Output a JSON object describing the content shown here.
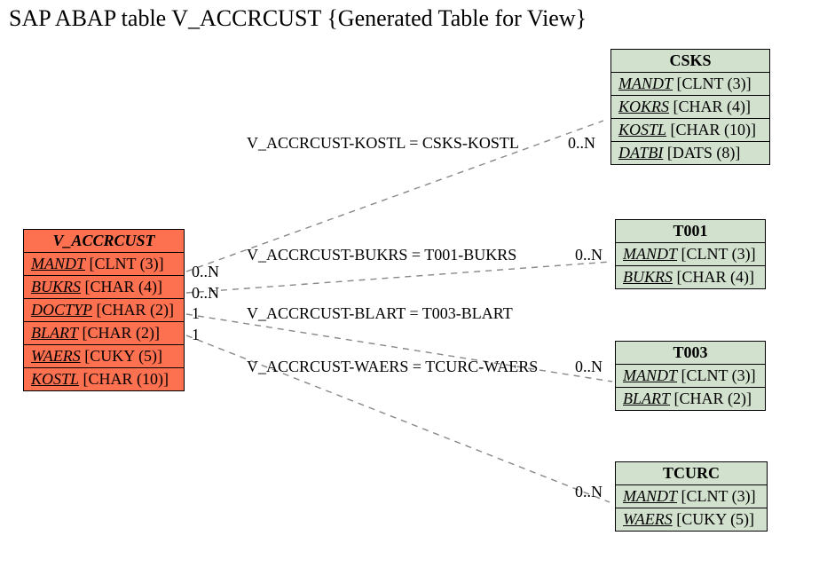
{
  "title": "SAP ABAP table V_ACCRCUST {Generated Table for View}",
  "main": {
    "name": "V_ACCRCUST",
    "fields": [
      {
        "name": "MANDT",
        "type": "[CLNT (3)]"
      },
      {
        "name": "BUKRS",
        "type": "[CHAR (4)]"
      },
      {
        "name": "DOCTYP",
        "type": "[CHAR (2)]"
      },
      {
        "name": "BLART",
        "type": "[CHAR (2)]"
      },
      {
        "name": "WAERS",
        "type": "[CUKY (5)]"
      },
      {
        "name": "KOSTL",
        "type": "[CHAR (10)]"
      }
    ]
  },
  "refs": {
    "csks": {
      "name": "CSKS",
      "fields": [
        {
          "name": "MANDT",
          "type": "[CLNT (3)]"
        },
        {
          "name": "KOKRS",
          "type": "[CHAR (4)]"
        },
        {
          "name": "KOSTL",
          "type": "[CHAR (10)]"
        },
        {
          "name": "DATBI",
          "type": "[DATS (8)]"
        }
      ]
    },
    "t001": {
      "name": "T001",
      "fields": [
        {
          "name": "MANDT",
          "type": "[CLNT (3)]"
        },
        {
          "name": "BUKRS",
          "type": "[CHAR (4)]"
        }
      ]
    },
    "t003": {
      "name": "T003",
      "fields": [
        {
          "name": "MANDT",
          "type": "[CLNT (3)]"
        },
        {
          "name": "BLART",
          "type": "[CHAR (2)]"
        }
      ]
    },
    "tcurc": {
      "name": "TCURC",
      "fields": [
        {
          "name": "MANDT",
          "type": "[CLNT (3)]"
        },
        {
          "name": "WAERS",
          "type": "[CUKY (5)]"
        }
      ]
    }
  },
  "relations": {
    "r1": {
      "label": "V_ACCRCUST-KOSTL = CSKS-KOSTL",
      "left_card": "0..N",
      "right_card": "0..N"
    },
    "r2": {
      "label": "V_ACCRCUST-BUKRS = T001-BUKRS",
      "left_card": "0..N",
      "right_card": "0..N"
    },
    "r3": {
      "label": "V_ACCRCUST-BLART = T003-BLART",
      "left_card": "1",
      "right_card": "0..N"
    },
    "r4": {
      "label": "V_ACCRCUST-WAERS = TCURC-WAERS",
      "left_card": "1",
      "right_card": "0..N"
    }
  }
}
